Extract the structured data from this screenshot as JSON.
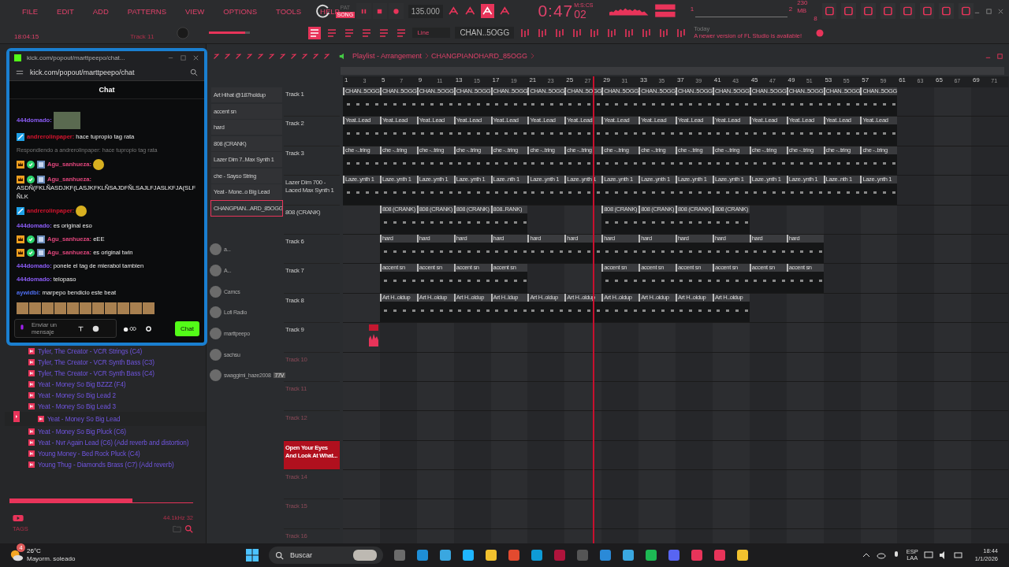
{
  "menu": [
    "FILE",
    "EDIT",
    "ADD",
    "PATTERNS",
    "VIEW",
    "OPTIONS",
    "TOOLS",
    "HELP"
  ],
  "transport": {
    "modes": [
      {
        "label": "PAT",
        "selected": false
      },
      {
        "label": "SONG",
        "selected": true
      }
    ],
    "tempo": "135.000",
    "time_main": "0:47",
    "time_format": "M:S:CS",
    "time_cs": "02"
  },
  "monitor": {
    "pattern_numbers": [
      "1",
      "2"
    ],
    "memory": "230 MB",
    "polyphony": "8"
  },
  "hint_bar": {
    "clock": "18:04:15",
    "target": "Track 11",
    "volume": {
      "level": 0.88
    },
    "snap": "Line",
    "pattern": "CHAN..5OGG",
    "news_date": "Today",
    "news_text": "A newer version of FL Studio is available!"
  },
  "browser": {
    "items": [
      {
        "label": "Tyler, The Creator - VCR Strings (C4)",
        "selected": false
      },
      {
        "label": "Tyler, The Creator - VCR Synth Bass (C3)",
        "selected": false
      },
      {
        "label": "Tyler, The Creator - VCR Synth Bass (C4)",
        "selected": false
      },
      {
        "label": "Yeat - Money So Big BZZZ (F4)",
        "selected": false
      },
      {
        "label": "Yeat - Money So Big Lead 2",
        "selected": false
      },
      {
        "label": "Yeat - Money So Big Lead 3",
        "selected": false
      },
      {
        "label": "Yeat - Money So Big Lead",
        "selected": true
      },
      {
        "label": "Yeat - Money So Big Pluck (C6)",
        "selected": false
      },
      {
        "label": "Yeat - Nvr Again Lead (C6) (Add reverb and distortion)",
        "selected": false
      },
      {
        "label": "Young Money - Bed Rock Pluck (C4)",
        "selected": false
      },
      {
        "label": "Young Thug - Diamonds Brass (C7) (Add reverb)",
        "selected": false
      }
    ],
    "preview": {
      "level": 0.67
    },
    "info": "44.1kHz 32",
    "tags_label": "TAGS"
  },
  "playlist": {
    "breadcrumb": [
      "Playlist - Arrangement",
      "CHANGPIANOHARD_85OGG"
    ],
    "channels": [
      {
        "name": "Art Hihat @187holdup",
        "selected": false
      },
      {
        "name": "accent sn",
        "selected": false
      },
      {
        "name": "hard",
        "selected": false
      },
      {
        "name": "808 (CRANK)",
        "selected": false
      },
      {
        "name": "Lazer Dim 7..Max Synth 1",
        "selected": false
      },
      {
        "name": "che - Sayso String",
        "selected": false
      },
      {
        "name": "Yeat - Mone..o Big Lead",
        "selected": false
      },
      {
        "name": "CHANGPIAN...ARD_85OGG",
        "selected": true
      }
    ],
    "voice_users": [
      {
        "name": "a..."
      },
      {
        "name": "A..."
      },
      {
        "name": "Camcs"
      },
      {
        "name": "Lofi Radio"
      },
      {
        "name": "marttpeepo"
      },
      {
        "name": "sachsu"
      },
      {
        "name": "swaggimi_haze2008",
        "tag": "77V"
      }
    ],
    "ruler": [
      "1",
      "3",
      "5",
      "7",
      "9",
      "11",
      "13",
      "15",
      "17",
      "19",
      "21",
      "23",
      "25",
      "27",
      "29",
      "31",
      "33",
      "35",
      "37",
      "39",
      "41",
      "43",
      "45",
      "47",
      "49",
      "51",
      "53",
      "55",
      "57",
      "59",
      "61",
      "63",
      "65",
      "67",
      "69",
      "71"
    ],
    "playhead": {
      "level": 0.376
    },
    "tracks": [
      {
        "name": "Track 1",
        "selected": false,
        "dimmed": false,
        "clips": [
          {
            "kind": "pattern",
            "label": "CHAN..5OGG"
          },
          {
            "kind": "pattern",
            "label": "CHAN..5OGG"
          },
          {
            "kind": "pattern",
            "label": "CHAN..5OGG"
          },
          {
            "kind": "pattern",
            "label": "CHAN..5OGG"
          },
          {
            "kind": "pattern",
            "label": "CHAN..5OGG"
          },
          {
            "kind": "pattern",
            "label": "CHAN..5OGG"
          },
          {
            "kind": "pattern",
            "label": "CHAN..5OGG"
          },
          {
            "kind": "pattern",
            "label": "CHAN..5OGG"
          },
          {
            "kind": "pattern",
            "label": "CHAN..5OGG"
          },
          {
            "kind": "pattern",
            "label": "CHAN..5OGG"
          },
          {
            "kind": "pattern",
            "label": "CHAN..5OGG"
          },
          {
            "kind": "pattern",
            "label": "CHAN..5OGG"
          },
          {
            "kind": "pattern",
            "label": "CHAN..5OGG"
          },
          {
            "kind": "pattern",
            "label": "CHAN..5OGG"
          },
          {
            "kind": "pattern",
            "label": "CHAN..5OGG"
          }
        ]
      },
      {
        "name": "Track 2",
        "selected": false,
        "dimmed": false,
        "clips": [
          {
            "kind": "pattern",
            "label": "Yeat..Lead"
          },
          {
            "kind": "pattern",
            "label": "Yeat..Lead"
          },
          {
            "kind": "pattern",
            "label": "Yeat..Lead"
          },
          {
            "kind": "pattern",
            "label": "Yeat..Lead"
          },
          {
            "kind": "pattern",
            "label": "Yeat..Lead"
          },
          {
            "kind": "pattern",
            "label": "Yeat..Lead"
          },
          {
            "kind": "pattern",
            "label": "Yeat..Lead"
          },
          {
            "kind": "pattern",
            "label": "Yeat..Lead"
          },
          {
            "kind": "pattern",
            "label": "Yeat..Lead"
          },
          {
            "kind": "pattern",
            "label": "Yeat..Lead"
          },
          {
            "kind": "pattern",
            "label": "Yeat..Lead"
          },
          {
            "kind": "pattern",
            "label": "Yeat..Lead"
          },
          {
            "kind": "pattern",
            "label": "Yeat..Lead"
          },
          {
            "kind": "pattern",
            "label": "Yeat..Lead"
          },
          {
            "kind": "pattern",
            "label": "Yeat..Lead"
          }
        ]
      },
      {
        "name": "Track 3",
        "selected": false,
        "dimmed": false,
        "clips": [
          {
            "kind": "pattern",
            "label": "che -..tring"
          },
          {
            "kind": "pattern",
            "label": "che -..tring"
          },
          {
            "kind": "pattern",
            "label": "che -..tring"
          },
          {
            "kind": "pattern",
            "label": "che -..tring"
          },
          {
            "kind": "pattern",
            "label": "che -..tring"
          },
          {
            "kind": "pattern",
            "label": "che -..tring"
          },
          {
            "kind": "pattern",
            "label": "che -..tring"
          },
          {
            "kind": "pattern",
            "label": "che -..tring"
          },
          {
            "kind": "pattern",
            "label": "che -..tring"
          },
          {
            "kind": "pattern",
            "label": "che -..tring"
          },
          {
            "kind": "pattern",
            "label": "che -..tring"
          },
          {
            "kind": "pattern",
            "label": "che -..tring"
          },
          {
            "kind": "pattern",
            "label": "che -..tring"
          },
          {
            "kind": "pattern",
            "label": "che -..tring"
          },
          {
            "kind": "pattern",
            "label": "che -..tring"
          }
        ]
      },
      {
        "name": "Lazer Dim 700 - Laced Max Synth 1",
        "selected": false,
        "dimmed": false,
        "clips": [
          {
            "kind": "pattern",
            "label": "Laze..ynth 1"
          },
          {
            "kind": "pattern",
            "label": "Laze..ynth 1"
          },
          {
            "kind": "pattern",
            "label": "Laze..ynth 1"
          },
          {
            "kind": "pattern",
            "label": "Laze..ynth 1"
          },
          {
            "kind": "pattern",
            "label": "Laze..nth 1"
          },
          {
            "kind": "pattern",
            "label": "Laze..ynth 1"
          },
          {
            "kind": "pattern",
            "label": "Laze..ynth 1"
          },
          {
            "kind": "pattern",
            "label": "Laze..ynth 1"
          },
          {
            "kind": "pattern",
            "label": "Laze..ynth 1"
          },
          {
            "kind": "pattern",
            "label": "Laze..ynth 1"
          },
          {
            "kind": "pattern",
            "label": "Laze..ynth 1"
          },
          {
            "kind": "pattern",
            "label": "Laze..ynth 1"
          },
          {
            "kind": "pattern",
            "label": "Laze..ynth 1"
          },
          {
            "kind": "pattern",
            "label": "Laze..nth 1"
          },
          {
            "kind": "pattern",
            "label": "Laze..ynth 1"
          }
        ]
      },
      {
        "name": "808 (CRANK)",
        "selected": false,
        "dimmed": false,
        "clips": [
          {
            "kind": "gap"
          },
          {
            "kind": "pattern",
            "label": "808 (CRANK)"
          },
          {
            "kind": "pattern",
            "label": "808 (CRANK)"
          },
          {
            "kind": "pattern",
            "label": "808 (CRANK)"
          },
          {
            "kind": "pattern",
            "label": "808..RANK)"
          },
          {
            "kind": "gap"
          },
          {
            "kind": "gap"
          },
          {
            "kind": "pattern",
            "label": "808 (CRANK)"
          },
          {
            "kind": "pattern",
            "label": "808 (CRANK)"
          },
          {
            "kind": "pattern",
            "label": "808 (CRANK)"
          },
          {
            "kind": "pattern",
            "label": "808 (CRANK)"
          }
        ]
      },
      {
        "name": "Track 6",
        "selected": false,
        "dimmed": false,
        "clips": [
          {
            "kind": "gap"
          },
          {
            "kind": "pattern",
            "label": "hard"
          },
          {
            "kind": "pattern",
            "label": "hard"
          },
          {
            "kind": "pattern",
            "label": "hard"
          },
          {
            "kind": "pattern",
            "label": "hard"
          },
          {
            "kind": "pattern",
            "label": "hard"
          },
          {
            "kind": "pattern",
            "label": "hard"
          },
          {
            "kind": "pattern",
            "label": "hard"
          },
          {
            "kind": "pattern",
            "label": "hard"
          },
          {
            "kind": "pattern",
            "label": "hard"
          },
          {
            "kind": "pattern",
            "label": "hard"
          },
          {
            "kind": "pattern",
            "label": "hard"
          },
          {
            "kind": "pattern",
            "label": "hard"
          }
        ]
      },
      {
        "name": "Track 7",
        "selected": false,
        "dimmed": false,
        "clips": [
          {
            "kind": "gap"
          },
          {
            "kind": "pattern",
            "label": "accent sn"
          },
          {
            "kind": "pattern",
            "label": "accent sn"
          },
          {
            "kind": "pattern",
            "label": "accent sn"
          },
          {
            "kind": "pattern",
            "label": "accent sn"
          },
          {
            "kind": "gap"
          },
          {
            "kind": "gap"
          },
          {
            "kind": "pattern",
            "label": "accent sn"
          },
          {
            "kind": "pattern",
            "label": "accent sn"
          },
          {
            "kind": "pattern",
            "label": "accent sn"
          },
          {
            "kind": "pattern",
            "label": "accent sn"
          },
          {
            "kind": "pattern",
            "label": "accent sn"
          },
          {
            "kind": "pattern",
            "label": "accent sn"
          }
        ]
      },
      {
        "name": "Track 8",
        "selected": false,
        "dimmed": false,
        "clips": [
          {
            "kind": "gap"
          },
          {
            "kind": "pattern",
            "label": "Art H..oldup"
          },
          {
            "kind": "pattern",
            "label": "Art H..oldup"
          },
          {
            "kind": "pattern",
            "label": "Art H..oldup"
          },
          {
            "kind": "pattern",
            "label": "Art H..ldup"
          },
          {
            "kind": "pattern",
            "label": "Art H..oldup"
          },
          {
            "kind": "pattern",
            "label": "Art H..oldup"
          },
          {
            "kind": "pattern",
            "label": "Art H..oldup"
          },
          {
            "kind": "pattern",
            "label": "Art H..oldup"
          },
          {
            "kind": "pattern",
            "label": "Art H..oldup"
          },
          {
            "kind": "pattern",
            "label": "Art H..oldup"
          }
        ]
      },
      {
        "name": "Track 9",
        "selected": false,
        "dimmed": false,
        "clips": [
          {
            "kind": "audio"
          }
        ]
      },
      {
        "name": "Track 10",
        "selected": false,
        "dimmed": true
      },
      {
        "name": "Track 11",
        "selected": false,
        "dimmed": true
      },
      {
        "name": "Track 12",
        "selected": false,
        "dimmed": true
      },
      {
        "name": "Open Your Eyes And Look At What...",
        "selected": true,
        "dimmed": false
      },
      {
        "name": "Track 14",
        "selected": false,
        "dimmed": true
      },
      {
        "name": "Track 15",
        "selected": false,
        "dimmed": true
      },
      {
        "name": "Track 16",
        "selected": false,
        "dimmed": true
      }
    ]
  },
  "chat_window": {
    "tab_title": "kick.com/popout/marttpeepo/chat...",
    "url": "kick.com/popout/marttpeepo/chat",
    "header": "Chat",
    "messages": [
      {
        "kind": "image",
        "user": "444domado:",
        "color": "#8b5cf6"
      },
      {
        "kind": "text",
        "user": "andrerolinpaper:",
        "color": "#d4142e",
        "badges": [
          {
            "kind": "moderator"
          }
        ],
        "text": "hace tupropio tag rata"
      },
      {
        "kind": "reply",
        "text": "Respondiendo a andrerolinpaper: hace tupropio tag rata"
      },
      {
        "kind": "emote",
        "user": "Agu_sanhueza:",
        "color": "#e0467c",
        "badges": [
          {
            "kind": "crown"
          },
          {
            "kind": "verified"
          },
          {
            "kind": "sub"
          }
        ]
      },
      {
        "kind": "text",
        "user": "Agu_sanhueza:",
        "color": "#e0467c",
        "badges": [
          {
            "kind": "crown"
          },
          {
            "kind": "verified"
          },
          {
            "kind": "sub"
          }
        ],
        "text": "ASDÑ(FKLÑASDJKF(LASJKFKLÑSAJDFÑLSAJLFJASLKFJA(SLFÑLK"
      },
      {
        "kind": "emote",
        "user": "andrerolinpaper:",
        "color": "#d4142e",
        "badges": [
          {
            "kind": "moderator"
          }
        ]
      },
      {
        "kind": "text",
        "user": "444domado:",
        "color": "#8b5cf6",
        "text": "es original eso"
      },
      {
        "kind": "text",
        "user": "Agu_sanhueza:",
        "color": "#e0467c",
        "badges": [
          {
            "kind": "crown"
          },
          {
            "kind": "verified"
          },
          {
            "kind": "sub"
          }
        ],
        "text": "eEE"
      },
      {
        "kind": "text",
        "user": "Agu_sanhueza:",
        "color": "#e0467c",
        "badges": [
          {
            "kind": "crown"
          },
          {
            "kind": "verified"
          },
          {
            "kind": "sub"
          }
        ],
        "text": "es original twin"
      },
      {
        "kind": "text",
        "user": "444domado:",
        "color": "#8b5cf6",
        "text": "ponele el tag de mierabol tambien"
      },
      {
        "kind": "text",
        "user": "444domado:",
        "color": "#8b5cf6",
        "text": "telopaso"
      },
      {
        "kind": "text",
        "user": "aywidbi:",
        "color": "#4f6ef0",
        "text": "marpepo bendicio este beat"
      }
    ],
    "placeholder": "Enviar un mensaje",
    "send_label": "Chat"
  },
  "taskbar": {
    "temperature": "26°C",
    "weather": "Mayorm. soleado",
    "weather_badge": "4",
    "search_placeholder": "Buscar",
    "language": "ESP",
    "layout": "LAA",
    "time": "18:44",
    "date": "1/1/2026"
  }
}
